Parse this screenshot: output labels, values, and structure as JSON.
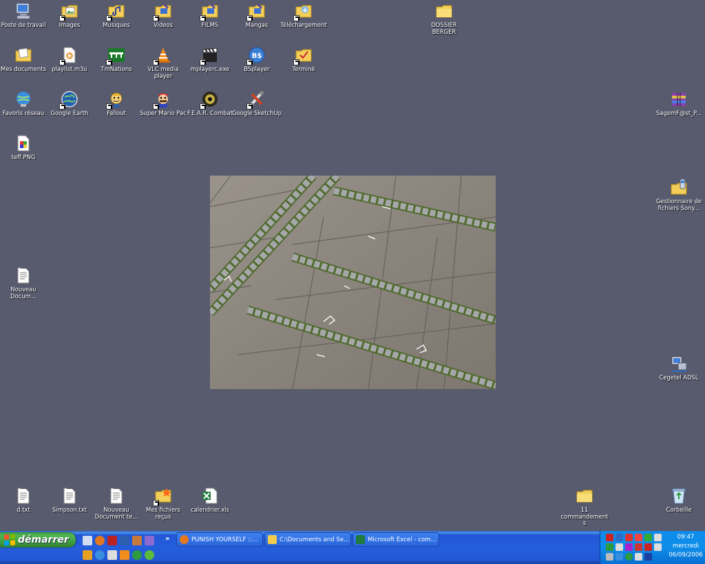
{
  "desktop": {
    "icons": [
      {
        "id": "poste",
        "label": "Poste de travail",
        "icon": "computer-icon",
        "shortcut": false
      },
      {
        "id": "images",
        "label": "Images",
        "icon": "folder-pictures-icon",
        "shortcut": true
      },
      {
        "id": "musiques",
        "label": "Musiques",
        "icon": "folder-music-icon",
        "shortcut": true
      },
      {
        "id": "videos",
        "label": "Videos",
        "icon": "folder-video-icon",
        "shortcut": true
      },
      {
        "id": "films",
        "label": "FILMS",
        "icon": "folder-video-icon",
        "shortcut": true
      },
      {
        "id": "mangas",
        "label": "Mangas",
        "icon": "folder-video-icon",
        "shortcut": true
      },
      {
        "id": "telechargement",
        "label": "Téléchargement",
        "icon": "folder-download-icon",
        "shortcut": true
      },
      {
        "id": "dossier-berger",
        "label": "DOSSIER BERGER",
        "icon": "folder-icon",
        "shortcut": false
      },
      {
        "id": "mes-documents",
        "label": "Mes documents",
        "icon": "my-documents-icon",
        "shortcut": false
      },
      {
        "id": "playlist",
        "label": "playlist.m3u",
        "icon": "playlist-file-icon",
        "shortcut": true
      },
      {
        "id": "tmnations",
        "label": "TmNations",
        "icon": "tmnations-icon",
        "shortcut": true
      },
      {
        "id": "vlc",
        "label": "VLC media player",
        "icon": "vlc-cone-icon",
        "shortcut": true
      },
      {
        "id": "mpc",
        "label": "mplayerc.exe",
        "icon": "clapperboard-icon",
        "shortcut": true
      },
      {
        "id": "bsplayer",
        "label": "BSplayer",
        "icon": "bsplayer-icon",
        "shortcut": true
      },
      {
        "id": "termine",
        "label": "Terminé",
        "icon": "folder-icon",
        "shortcut": true
      },
      {
        "id": "favoris",
        "label": "Favoris réseau",
        "icon": "network-places-icon",
        "shortcut": false
      },
      {
        "id": "google-earth",
        "label": "Google Earth",
        "icon": "globe-icon",
        "shortcut": true
      },
      {
        "id": "fallout",
        "label": "Fallout",
        "icon": "vault-boy-icon",
        "shortcut": true
      },
      {
        "id": "smp",
        "label": "Super Mario Pac",
        "icon": "mario-icon",
        "shortcut": true
      },
      {
        "id": "fear",
        "label": "F.E.A.R. Combat",
        "icon": "fear-eye-icon",
        "shortcut": true
      },
      {
        "id": "sketchup",
        "label": "Google SketchUp",
        "icon": "sketchup-icon",
        "shortcut": true
      },
      {
        "id": "teff",
        "label": "teff.PNG",
        "icon": "image-file-icon",
        "shortcut": false
      },
      {
        "id": "sagem",
        "label": "SagemF@st_P...",
        "icon": "winrar-archive-icon",
        "shortcut": false
      },
      {
        "id": "sony",
        "label": "Gestionnaire de fichiers Sony...",
        "icon": "phone-folder-icon",
        "shortcut": false
      },
      {
        "id": "nouveau1",
        "label": "Nouveau Docum...",
        "icon": "text-file-icon",
        "shortcut": false
      },
      {
        "id": "cegetel",
        "label": "Cegetel ADSL",
        "icon": "network-computer-icon",
        "shortcut": false
      },
      {
        "id": "dtxt",
        "label": "d.txt",
        "icon": "text-file-icon",
        "shortcut": false
      },
      {
        "id": "simpson",
        "label": "Simpson.txt",
        "icon": "text-file-icon",
        "shortcut": false
      },
      {
        "id": "nouveau2",
        "label": "Nouveau Document te...",
        "icon": "text-file-icon",
        "shortcut": false
      },
      {
        "id": "fichiers-recus",
        "label": "Mes fichiers reçus",
        "icon": "folder-received-icon",
        "shortcut": true
      },
      {
        "id": "calendrier",
        "label": "calendrier.xls",
        "icon": "excel-file-icon",
        "shortcut": false
      },
      {
        "id": "commandements",
        "label": "11 commandements",
        "icon": "folder-icon",
        "shortcut": false
      },
      {
        "id": "corbeille",
        "label": "Corbeille",
        "icon": "recycle-bin-icon",
        "shortcut": false
      }
    ]
  },
  "taskbar": {
    "start_label": "démarrer",
    "tasks": [
      {
        "label": "PUNISH YOURSELF ::...",
        "icon": "firefox-icon",
        "color": "#e5771e"
      },
      {
        "label": "C:\\Documents and Se...",
        "icon": "folder-icon",
        "color": "#f2cc4a"
      },
      {
        "label": "Microsoft Excel - com...",
        "icon": "excel-icon",
        "color": "#1f7a3c"
      }
    ],
    "clock": {
      "time": "09:47",
      "day": "mercredi",
      "date": "06/09/2006"
    }
  }
}
